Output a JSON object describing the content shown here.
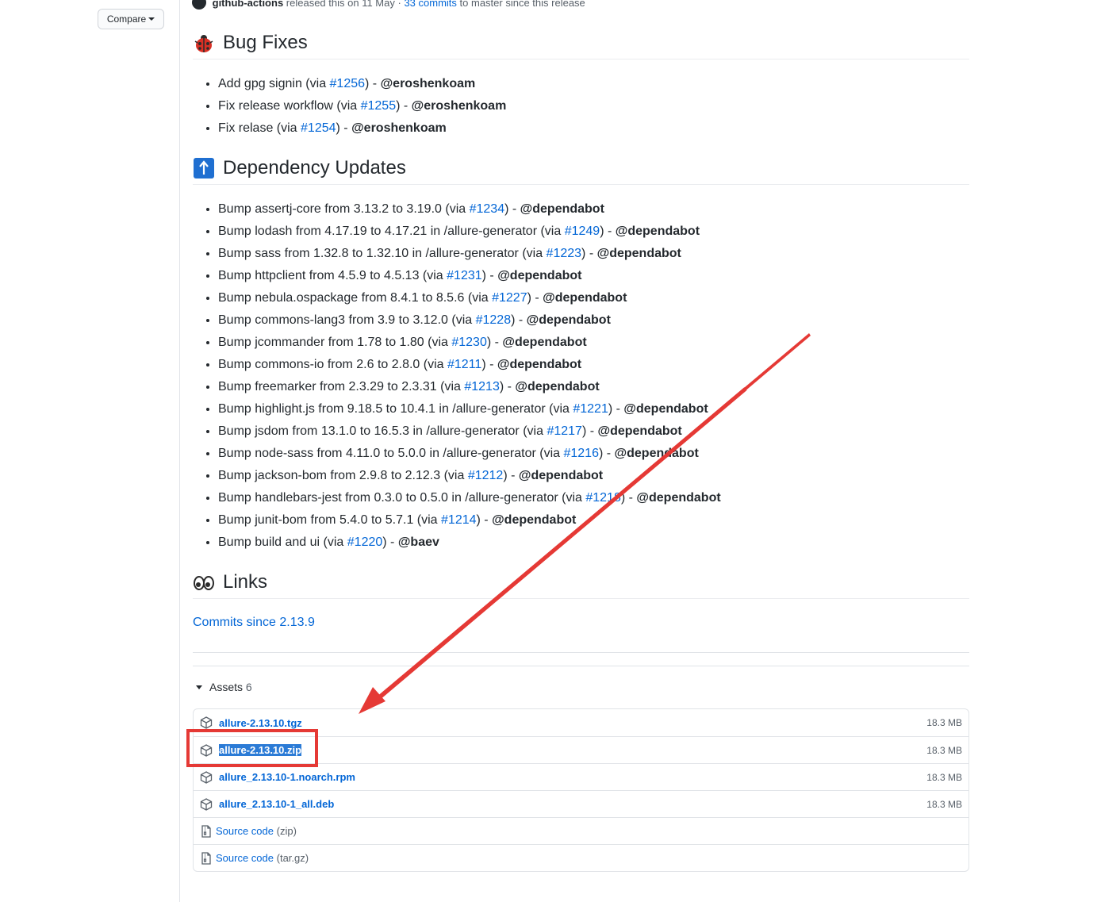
{
  "sidebar": {
    "compare_label": "Compare"
  },
  "release_meta": {
    "author": "github-actions",
    "released": "released this on 11 May",
    "sep": "·",
    "commits_link": "33 commits",
    "commits_suffix": "to master since this release"
  },
  "bug_fixes": {
    "title": "Bug Fixes",
    "items": [
      {
        "text": "Add gpg signin (via ",
        "pr": "#1256",
        "sep": ") - ",
        "author": "@eroshenkoam"
      },
      {
        "text": "Fix release workflow (via ",
        "pr": "#1255",
        "sep": ") - ",
        "author": "@eroshenkoam"
      },
      {
        "text": "Fix relase (via ",
        "pr": "#1254",
        "sep": ") - ",
        "author": "@eroshenkoam"
      }
    ]
  },
  "dependency_updates": {
    "title": "Dependency Updates",
    "items": [
      {
        "text": "Bump assertj-core from 3.13.2 to 3.19.0 (via ",
        "pr": "#1234",
        "sep": ") - ",
        "author": "@dependabot"
      },
      {
        "text": "Bump lodash from 4.17.19 to 4.17.21 in /allure-generator (via ",
        "pr": "#1249",
        "sep": ") - ",
        "author": "@dependabot"
      },
      {
        "text": "Bump sass from 1.32.8 to 1.32.10 in /allure-generator (via ",
        "pr": "#1223",
        "sep": ") - ",
        "author": "@dependabot"
      },
      {
        "text": "Bump httpclient from 4.5.9 to 4.5.13 (via ",
        "pr": "#1231",
        "sep": ") - ",
        "author": "@dependabot"
      },
      {
        "text": "Bump nebula.ospackage from 8.4.1 to 8.5.6 (via ",
        "pr": "#1227",
        "sep": ") - ",
        "author": "@dependabot"
      },
      {
        "text": "Bump commons-lang3 from 3.9 to 3.12.0 (via ",
        "pr": "#1228",
        "sep": ") - ",
        "author": "@dependabot"
      },
      {
        "text": "Bump jcommander from 1.78 to 1.80 (via ",
        "pr": "#1230",
        "sep": ") - ",
        "author": "@dependabot"
      },
      {
        "text": "Bump commons-io from 2.6 to 2.8.0 (via ",
        "pr": "#1211",
        "sep": ") - ",
        "author": "@dependabot"
      },
      {
        "text": "Bump freemarker from 2.3.29 to 2.3.31 (via ",
        "pr": "#1213",
        "sep": ") - ",
        "author": "@dependabot"
      },
      {
        "text": "Bump highlight.js from 9.18.5 to 10.4.1 in /allure-generator (via ",
        "pr": "#1221",
        "sep": ") - ",
        "author": "@dependabot"
      },
      {
        "text": "Bump jsdom from 13.1.0 to 16.5.3 in /allure-generator (via ",
        "pr": "#1217",
        "sep": ") - ",
        "author": "@dependabot"
      },
      {
        "text": "Bump node-sass from 4.11.0 to 5.0.0 in /allure-generator (via ",
        "pr": "#1216",
        "sep": ") - ",
        "author": "@dependabot"
      },
      {
        "text": "Bump jackson-bom from 2.9.8 to 2.12.3 (via ",
        "pr": "#1212",
        "sep": ") - ",
        "author": "@dependabot"
      },
      {
        "text": "Bump handlebars-jest from 0.3.0 to 0.5.0 in /allure-generator (via ",
        "pr": "#1218",
        "sep": ") - ",
        "author": "@dependabot"
      },
      {
        "text": "Bump junit-bom from 5.4.0 to 5.7.1 (via ",
        "pr": "#1214",
        "sep": ") - ",
        "author": "@dependabot"
      },
      {
        "text": "Bump build and ui (via ",
        "pr": "#1220",
        "sep": ") - ",
        "author": "@baev"
      }
    ]
  },
  "links": {
    "title": "Links",
    "commits_since": "Commits since 2.13.9"
  },
  "assets": {
    "label": "Assets",
    "count": "6",
    "files": [
      {
        "name": "allure-2.13.10.tgz",
        "size": "18.3 MB"
      },
      {
        "name": "allure-2.13.10.zip",
        "size": "18.3 MB"
      },
      {
        "name": "allure_2.13.10-1.noarch.rpm",
        "size": "18.3 MB"
      },
      {
        "name": "allure_2.13.10-1_all.deb",
        "size": "18.3 MB"
      }
    ],
    "sources": [
      {
        "name": "Source code",
        "fmt": "(zip)"
      },
      {
        "name": "Source code",
        "fmt": "(tar.gz)"
      }
    ]
  },
  "colors": {
    "link": "#0366d6",
    "annotation": "#e53935",
    "selection": "#2b7bd6"
  }
}
